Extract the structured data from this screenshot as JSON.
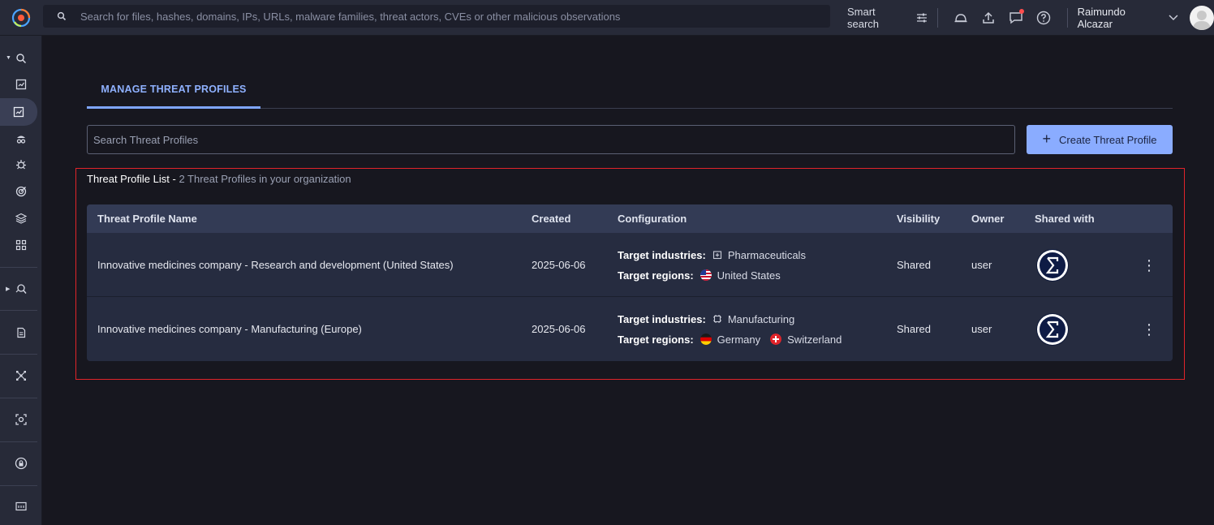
{
  "topbar": {
    "search_placeholder": "Search for files, hashes, domains, IPs, URLs, malware families, threat actors, CVEs or other malicious observations",
    "smart_search_label": "Smart search",
    "user_name": "Raimundo Alcazar"
  },
  "tabs": [
    {
      "label": "MANAGE THREAT PROFILES",
      "active": true
    }
  ],
  "profile_search": {
    "placeholder": "Search Threat Profiles"
  },
  "create_button": {
    "label": "Create Threat Profile"
  },
  "list": {
    "title": "Threat Profile List - ",
    "subtitle": "2 Threat Profiles in your organization"
  },
  "table": {
    "columns": {
      "name": "Threat Profile Name",
      "created": "Created",
      "configuration": "Configuration",
      "visibility": "Visibility",
      "owner": "Owner",
      "shared_with": "Shared with"
    },
    "config_labels": {
      "industries": "Target industries:",
      "regions": "Target regions:"
    },
    "rows": [
      {
        "name": "Innovative medicines company - Research and development (United States)",
        "created": "2025-06-06",
        "industries": [
          "Pharmaceuticals"
        ],
        "regions": [
          "United States"
        ],
        "visibility": "Shared",
        "owner": "user"
      },
      {
        "name": "Innovative medicines company - Manufacturing (Europe)",
        "created": "2025-06-06",
        "industries": [
          "Manufacturing"
        ],
        "regions": [
          "Germany",
          "Switzerland"
        ],
        "visibility": "Shared",
        "owner": "user"
      }
    ]
  },
  "colors": {
    "accent": "#8aacff",
    "tab_active": "#8fb1ff",
    "highlight_border": "#e0242a",
    "background": "#17171f",
    "panel": "#272a38"
  },
  "icons": {
    "sidebar": [
      "search-icon",
      "report-icon",
      "threat-profile-icon",
      "threat-actor-icon",
      "malware-icon",
      "target-icon",
      "layers-icon",
      "apps-icon",
      "graph-search-icon",
      "document-icon",
      "network-icon",
      "scan-icon",
      "lock-icon",
      "console-icon"
    ]
  }
}
